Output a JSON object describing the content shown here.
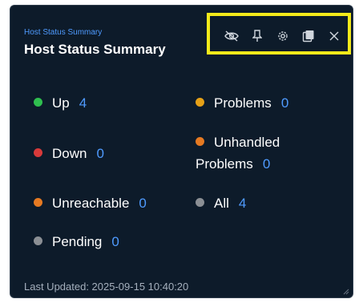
{
  "widget": {
    "subtitle": "Host Status Summary",
    "title": "Host Status Summary",
    "footer": "Last Updated: 2025-09-15 10:40:20"
  },
  "toolbar": {
    "icons": [
      "eye-off-icon",
      "pin-icon",
      "gear-icon",
      "copy-icon",
      "close-icon"
    ]
  },
  "statuses": {
    "up": {
      "label": "Up",
      "count": "4",
      "color": "#2fbf4f"
    },
    "problems": {
      "label": "Problems",
      "count": "0",
      "color": "#e6a117"
    },
    "down": {
      "label": "Down",
      "count": "0",
      "color": "#d83a3a"
    },
    "unhandled": {
      "label_line1": "Unhandled",
      "label_line2": "Problems",
      "count": "0",
      "color": "#e67a22"
    },
    "unreachable": {
      "label": "Unreachable",
      "count": "0",
      "color": "#e67a22"
    },
    "all": {
      "label": "All",
      "count": "4",
      "color": "#8b8f94"
    },
    "pending": {
      "label": "Pending",
      "count": "0",
      "color": "#8b8f94"
    }
  },
  "colors": {
    "background": "#0d1b2a",
    "accent": "#4f9bff",
    "highlight": "#f4ea1a"
  }
}
